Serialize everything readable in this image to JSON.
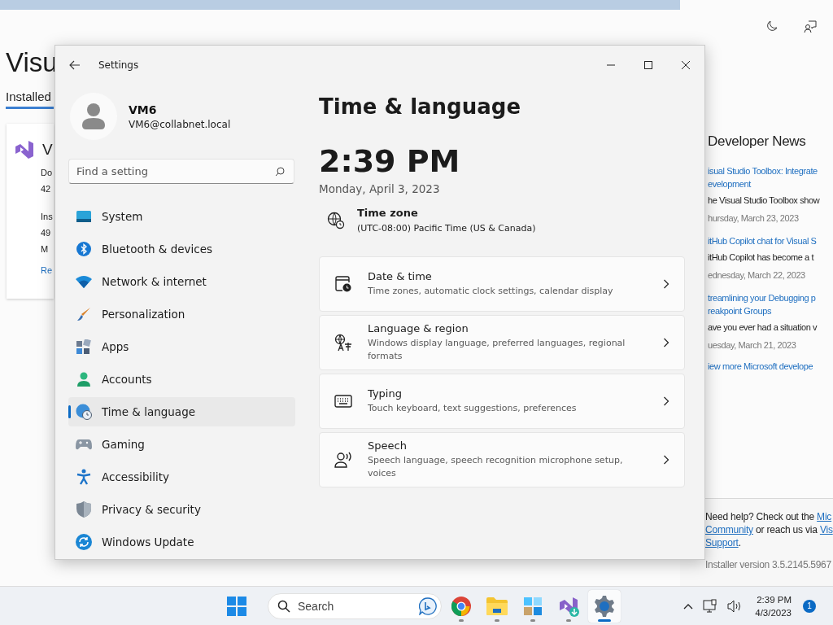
{
  "background_window": {
    "title": "Visu",
    "tab": "Installed",
    "product": {
      "name": "V",
      "lines": [
        "Do",
        "42",
        "Ins",
        "49",
        "M"
      ],
      "link": "Re"
    },
    "news": {
      "heading": "Developer News",
      "items": [
        {
          "title": [
            "isual Studio Toolbox: Integrate",
            "evelopment"
          ],
          "summary": "he Visual Studio Toolbox show",
          "date": "hursday, March 23, 2023"
        },
        {
          "title": [
            "itHub Copilot chat for Visual S"
          ],
          "summary": "itHub Copilot has become a t",
          "date": "ednesday, March 22, 2023"
        },
        {
          "title": [
            "treamlining your Debugging p",
            "reakpoint Groups"
          ],
          "summary": "ave you ever had a situation v",
          "date": "uesday, March 21, 2023"
        }
      ],
      "more": "iew more Microsoft develope"
    },
    "help": {
      "text": "Need help? Check out the",
      "link1": "Mic",
      "link2": "Community",
      "middle": "or reach us via",
      "link3": "Vis",
      "link4": "Support",
      "end": "."
    },
    "version": "Installer version 3.5.2145.5967"
  },
  "window": {
    "title": "Settings"
  },
  "user": {
    "name": "VM6",
    "email": "VM6@collabnet.local"
  },
  "search": {
    "placeholder": "Find a setting"
  },
  "sidebar": {
    "items": [
      {
        "label": "System",
        "selected": false
      },
      {
        "label": "Bluetooth & devices",
        "selected": false
      },
      {
        "label": "Network & internet",
        "selected": false
      },
      {
        "label": "Personalization",
        "selected": false
      },
      {
        "label": "Apps",
        "selected": false
      },
      {
        "label": "Accounts",
        "selected": false
      },
      {
        "label": "Time & language",
        "selected": true
      },
      {
        "label": "Gaming",
        "selected": false
      },
      {
        "label": "Accessibility",
        "selected": false
      },
      {
        "label": "Privacy & security",
        "selected": false
      },
      {
        "label": "Windows Update",
        "selected": false
      }
    ]
  },
  "page": {
    "title": "Time & language",
    "time": "2:39 PM",
    "date": "Monday, April 3, 2023",
    "timezone": {
      "label": "Time zone",
      "value": "(UTC-08:00) Pacific Time (US & Canada)"
    },
    "cards": [
      {
        "title": "Date & time",
        "description": "Time zones, automatic clock settings, calendar display"
      },
      {
        "title": "Language & region",
        "description": "Windows display language, preferred languages, regional formats"
      },
      {
        "title": "Typing",
        "description": "Touch keyboard, text suggestions, preferences"
      },
      {
        "title": "Speech",
        "description": "Speech language, speech recognition microphone setup, voices"
      }
    ]
  },
  "taskbar": {
    "search_placeholder": "Search",
    "apps": [
      {
        "selected": false
      },
      {
        "selected": false
      },
      {
        "selected": false
      },
      {
        "selected": false
      },
      {
        "selected": true
      }
    ],
    "clock": {
      "time": "2:39 PM",
      "date": "4/3/2023"
    },
    "notification_count": "1"
  }
}
